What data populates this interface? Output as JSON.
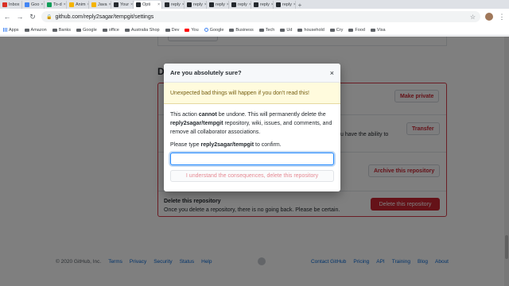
{
  "browser": {
    "tabs": [
      {
        "label": "Inbox",
        "color": "#d93025"
      },
      {
        "label": "Goo",
        "color": "#4285f4"
      },
      {
        "label": "To-d",
        "color": "#0f9d58"
      },
      {
        "label": "Anim",
        "color": "#f4b400"
      },
      {
        "label": "Java",
        "color": "#f4b400"
      },
      {
        "label": "Your",
        "color": "#24292e"
      },
      {
        "label": "Opti",
        "color": "#24292e",
        "active": true
      },
      {
        "label": "reply",
        "color": "#24292e"
      },
      {
        "label": "reply",
        "color": "#24292e"
      },
      {
        "label": "reply",
        "color": "#24292e"
      },
      {
        "label": "reply",
        "color": "#24292e"
      },
      {
        "label": "reply",
        "color": "#24292e"
      },
      {
        "label": "reply",
        "color": "#24292e"
      }
    ],
    "new_tab": "+",
    "nav": {
      "back": "←",
      "forward": "→",
      "reload": "C",
      "home": "⌂"
    },
    "url": "github.com/reply2sagar/tempgit/settings",
    "bookmarks": [
      {
        "label": "Apps",
        "icon": "grid-icon"
      },
      {
        "label": "Amazon",
        "icon": "folder-icon"
      },
      {
        "label": "Banks",
        "icon": "folder-icon"
      },
      {
        "label": "Google",
        "icon": "folder-icon"
      },
      {
        "label": "office",
        "icon": "folder-icon"
      },
      {
        "label": "Australia Shop",
        "icon": "folder-icon"
      },
      {
        "label": "Dev",
        "icon": "folder-icon"
      },
      {
        "label": "You",
        "icon": "youtube-icon"
      },
      {
        "label": "Google",
        "icon": "google-icon"
      },
      {
        "label": "Business",
        "icon": "folder-icon"
      },
      {
        "label": "Tech",
        "icon": "folder-icon"
      },
      {
        "label": "Ud",
        "icon": "folder-icon"
      },
      {
        "label": "household",
        "icon": "folder-icon"
      },
      {
        "label": "Cry",
        "icon": "folder-icon"
      },
      {
        "label": "Food",
        "icon": "folder-icon"
      },
      {
        "label": "Visa",
        "icon": "folder-icon"
      }
    ]
  },
  "page": {
    "danger_heading": "D",
    "make_private_label": "Make private",
    "transfer_label": "Transfer",
    "transfer_text": "u have the ability to",
    "archive_label": "Archive this repository",
    "delete_title": "Delete this repository",
    "delete_desc": "Once you delete a repository, there is no going back. Please be certain.",
    "delete_label": "Delete this repository"
  },
  "footer": {
    "copyright": "© 2020 GitHub, Inc.",
    "left_links": [
      "Terms",
      "Privacy",
      "Security",
      "Status",
      "Help"
    ],
    "right_links": [
      "Contact GitHub",
      "Pricing",
      "API",
      "Training",
      "Blog",
      "About"
    ]
  },
  "dialog": {
    "title": "Are you absolutely sure?",
    "close": "×",
    "warning": "Unexpected bad things will happen if you don't read this!",
    "body_part1": "This action ",
    "body_bold1": "cannot",
    "body_part2": " be undone. This will permanently delete the ",
    "body_bold2": "reply2sagar/tempgit",
    "body_part3": " repository, wiki, issues, and comments, and remove all collaborator associations.",
    "confirm_prefix": "Please type ",
    "confirm_bold": "reply2sagar/tempgit",
    "confirm_suffix": " to confirm.",
    "input_value": "",
    "submit_label": "I understand the consequences, delete this repository"
  },
  "colors": {
    "danger": "#cb2431",
    "link": "#0366d6",
    "warning_bg": "#fffbdd"
  }
}
